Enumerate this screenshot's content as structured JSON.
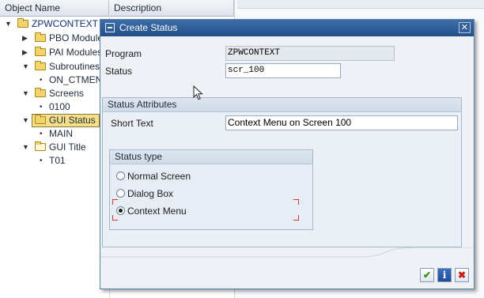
{
  "navigator": {
    "headers": {
      "object_name": "Object Name",
      "description": "Description"
    },
    "rows": [
      {
        "label": "ZPWCONTEXT",
        "icon": "folder-icon",
        "expand": "down"
      },
      {
        "label": "PBO Modules",
        "icon": "folder-icon",
        "expand": "right"
      },
      {
        "label": "PAI Modules",
        "icon": "folder-icon",
        "expand": "right"
      },
      {
        "label": "Subroutines",
        "icon": "folder-icon",
        "expand": "down"
      },
      {
        "label": "ON_CTMENU",
        "icon": "bullet",
        "expand": "none"
      },
      {
        "label": "Screens",
        "icon": "folder-icon",
        "expand": "down"
      },
      {
        "label": "0100",
        "icon": "bullet",
        "expand": "none"
      },
      {
        "label": "GUI Status",
        "icon": "folder-icon",
        "expand": "down"
      },
      {
        "label": "MAIN",
        "icon": "bullet",
        "expand": "none"
      },
      {
        "label": "GUI Title",
        "icon": "open-folder-icon",
        "expand": "down"
      },
      {
        "label": "T01",
        "icon": "bullet",
        "expand": "none"
      }
    ]
  },
  "dialog": {
    "title": "Create Status",
    "close_glyph": "✕",
    "program_label": "Program",
    "program_value": "ZPWCONTEXT",
    "status_label": "Status",
    "status_value": "scr_100",
    "attributes_title": "Status Attributes",
    "short_text_label": "Short Text",
    "short_text_value": "Context Menu on Screen 100",
    "status_type_title": "Status type",
    "options": [
      {
        "label": "Normal Screen",
        "selected": false
      },
      {
        "label": "Dialog Box",
        "selected": false
      },
      {
        "label": "Context Menu",
        "selected": true
      }
    ],
    "buttons": {
      "ok": "✔",
      "info": "i",
      "cancel": "✖"
    }
  },
  "colors": {
    "titlebar": "#2d5e9a",
    "selection": "#f7df8a",
    "focus": "#d23b2b"
  }
}
